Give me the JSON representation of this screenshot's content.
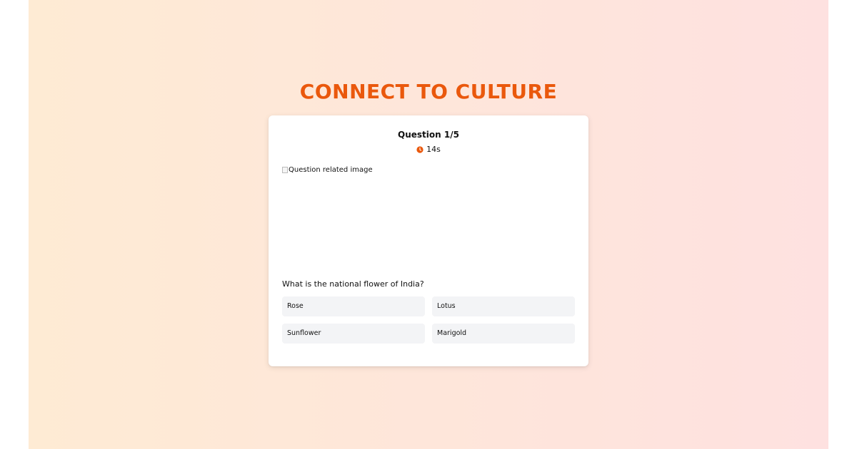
{
  "app": {
    "title": "CONNECT TO CULTURE"
  },
  "quiz": {
    "question_counter": "Question 1/5",
    "timer": "14s",
    "timer_icon": "clock-icon",
    "image_alt": "Question related image",
    "question": "What is the national flower of India?",
    "options": [
      {
        "label": "Rose"
      },
      {
        "label": "Lotus"
      },
      {
        "label": "Sunflower"
      },
      {
        "label": "Marigold"
      }
    ]
  },
  "colors": {
    "accent": "#ea580c",
    "background_start": "#feebd4",
    "background_end": "#fee1e0",
    "card": "#ffffff",
    "option_bg": "#f3f4f6"
  }
}
